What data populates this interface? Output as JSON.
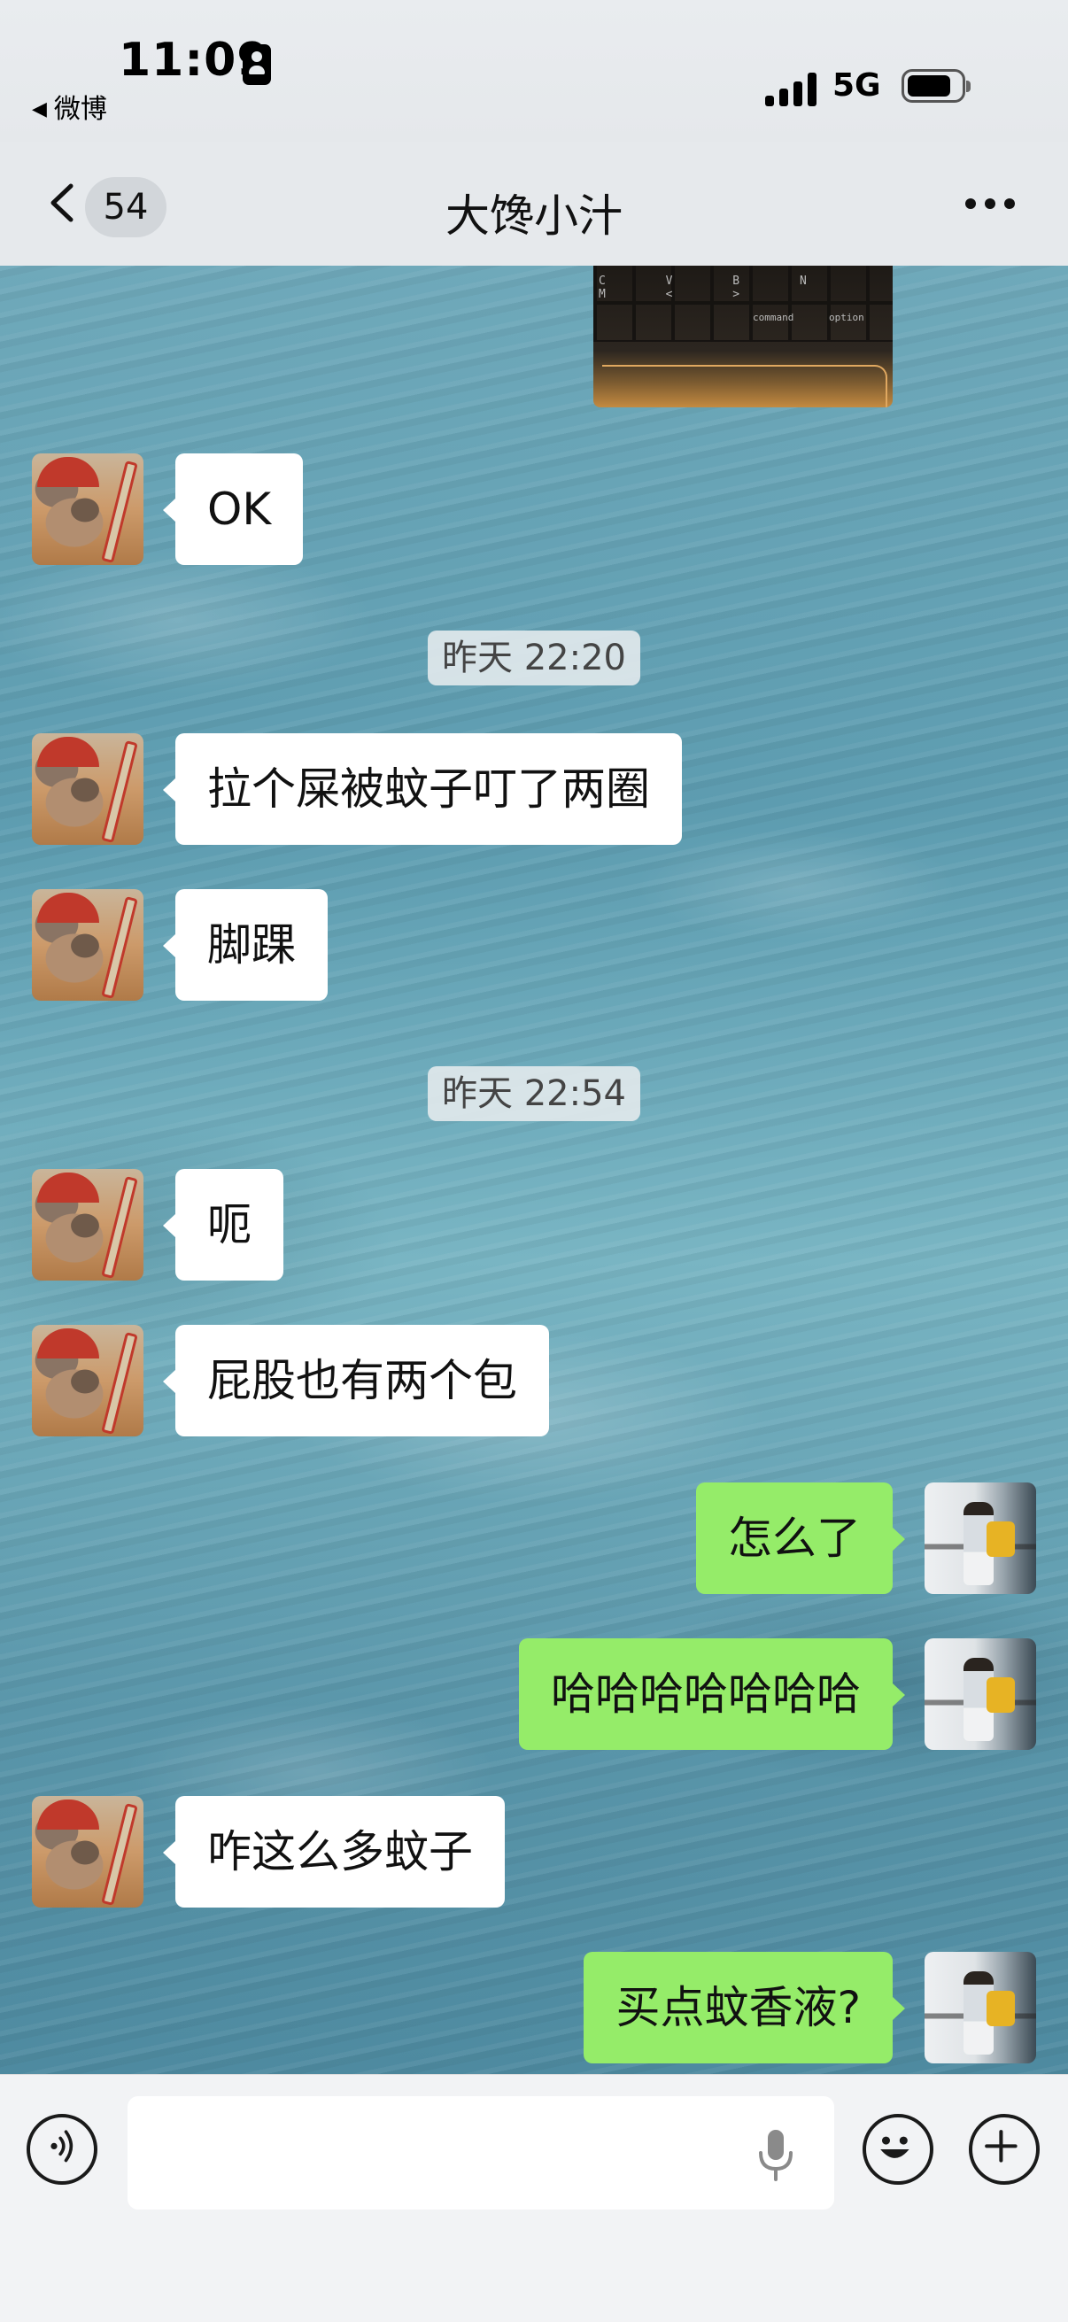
{
  "status_bar": {
    "time": "11:09",
    "back_app": "微博",
    "network": "5G"
  },
  "nav": {
    "unread_count": "54",
    "title": "大馋小汁"
  },
  "chat": {
    "messages": [
      {
        "type": "image",
        "side": "right",
        "content": "laptop keyboard photo",
        "keycap_text": "C V B N M < >",
        "keycap_labels": [
          "command",
          "option"
        ]
      },
      {
        "type": "text",
        "side": "left",
        "text": "OK"
      },
      {
        "type": "time",
        "text": "昨天 22:20"
      },
      {
        "type": "text",
        "side": "left",
        "text": "拉个屎被蚊子叮了两圈"
      },
      {
        "type": "text",
        "side": "left",
        "text": "脚踝"
      },
      {
        "type": "time",
        "text": "昨天 22:54"
      },
      {
        "type": "text",
        "side": "left",
        "text": "呃"
      },
      {
        "type": "text",
        "side": "left",
        "text": "屁股也有两个包"
      },
      {
        "type": "text",
        "side": "right",
        "text": "怎么了"
      },
      {
        "type": "text",
        "side": "right",
        "text": "哈哈哈哈哈哈哈"
      },
      {
        "type": "text",
        "side": "left",
        "text": "咋这么多蚊子"
      },
      {
        "type": "text",
        "side": "right",
        "text": "买点蚊香液?"
      }
    ]
  },
  "input_bar": {
    "placeholder": "",
    "value": ""
  },
  "icons": {
    "voice": "voice-icon",
    "mic": "microphone-icon",
    "emoji": "emoji-icon",
    "plus": "plus-icon",
    "back": "chevron-left-icon",
    "more": "more-icon"
  },
  "colors": {
    "bubble_self": "#95ec69",
    "bubble_other": "#ffffff",
    "nav_bg": "#e6e9ec",
    "input_bar_bg": "#f2f3f5"
  }
}
